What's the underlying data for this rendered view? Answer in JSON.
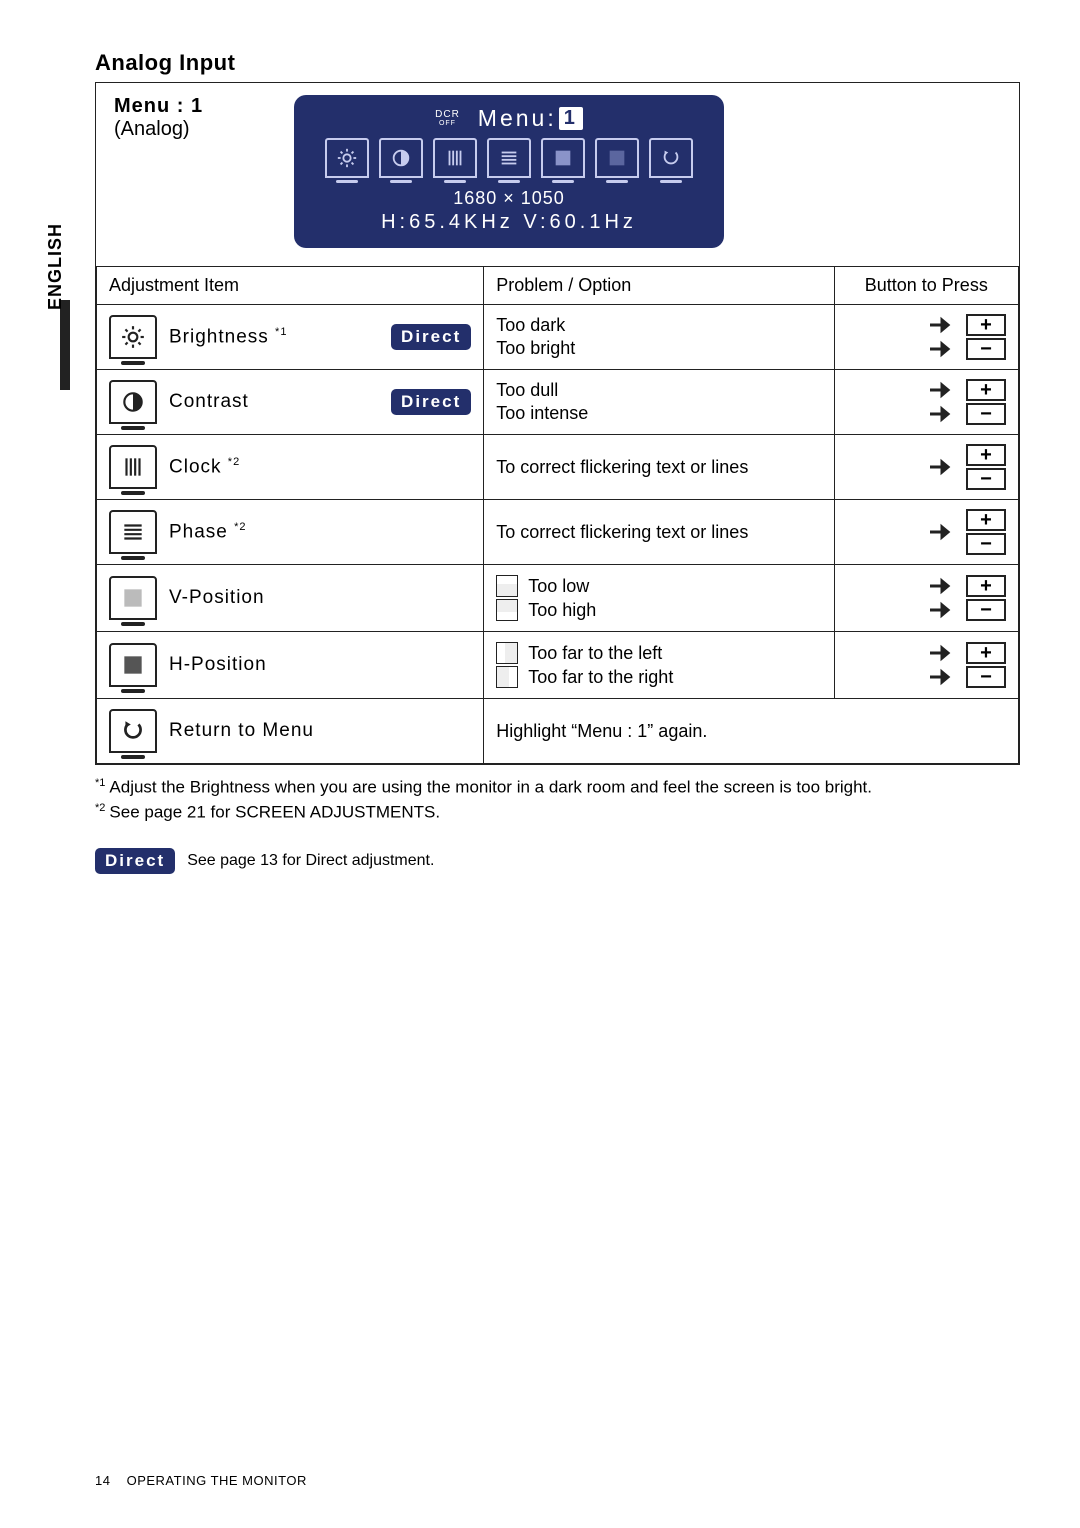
{
  "language_tab": "ENGLISH",
  "heading": "Analog Input",
  "menu": {
    "title": "Menu : 1",
    "subtitle": "(Analog)"
  },
  "osd": {
    "dcr": "DCR",
    "dcr_state": "OFF",
    "menu_label": "Menu:",
    "menu_number": "1",
    "resolution": "1680 × 1050",
    "freq": "H:65.4KHz  V:60.1Hz"
  },
  "table": {
    "headers": {
      "adj": "Adjustment Item",
      "prob": "Problem / Option",
      "btn": "Button to Press"
    },
    "rows": {
      "brightness": {
        "label": "Brightness ",
        "note": "*1",
        "direct": "Direct",
        "problems": [
          "Too dark",
          "Too bright"
        ]
      },
      "contrast": {
        "label": "Contrast",
        "direct": "Direct",
        "problems": [
          "Too dull",
          "Too intense"
        ]
      },
      "clock": {
        "label": "Clock ",
        "note": "*2",
        "problem": "To correct flickering text or lines"
      },
      "phase": {
        "label": "Phase ",
        "note": "*2",
        "problem": "To correct flickering text or lines"
      },
      "vpos": {
        "label": "V-Position",
        "problems": [
          "Too low",
          "Too high"
        ]
      },
      "hpos": {
        "label": "H-Position",
        "problems": [
          "Too far to the left",
          "Too far to the right"
        ]
      },
      "return": {
        "label": "Return to Menu",
        "problem": "Highlight “Menu : 1” again."
      }
    }
  },
  "footnotes": {
    "f1_mark": "*1",
    "f1": "Adjust the Brightness when you are using the monitor in a dark room and feel the screen is too bright.",
    "f2_mark": "*2",
    "f2": "See page 21 for SCREEN ADJUSTMENTS."
  },
  "direct_note": {
    "badge": "Direct",
    "text": "See page 13 for Direct adjustment."
  },
  "footer": {
    "page": "14",
    "section": "OPERATING THE MONITOR"
  }
}
